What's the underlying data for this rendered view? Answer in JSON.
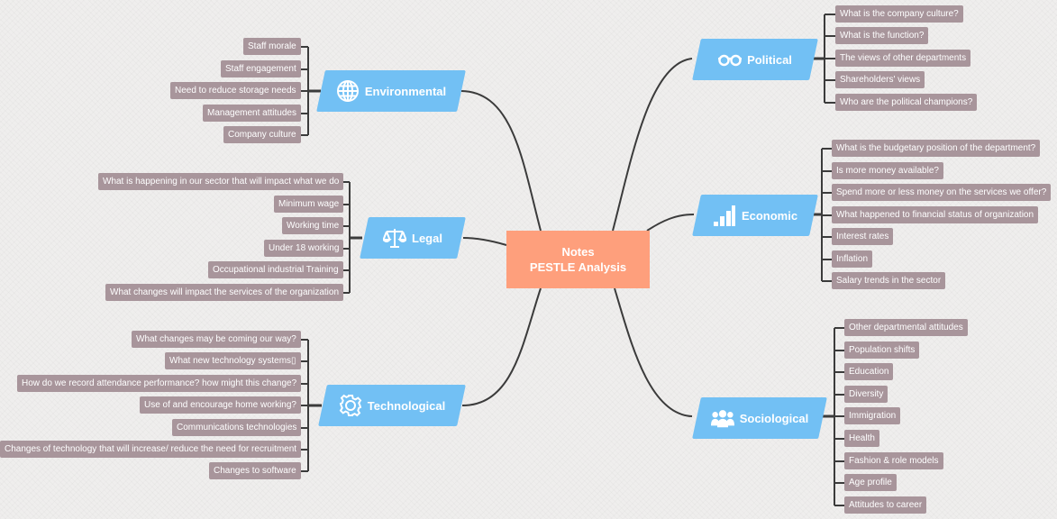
{
  "central": {
    "line1": "Notes",
    "line2": "PESTLE Analysis"
  },
  "colors": {
    "central": "#fe9f7c",
    "topic": "#72c0f4",
    "leaf": "#a8959b",
    "line": "#3b3b3b"
  },
  "topics": {
    "political": {
      "label": "Political",
      "icon": "glasses-icon",
      "items": [
        "What is the company culture?",
        "What is the function?",
        "The views of other departments",
        "Shareholders' views",
        "Who are the political champions?"
      ]
    },
    "economic": {
      "label": "Economic",
      "icon": "bar-chart-icon",
      "items": [
        "What is the budgetary position of the department?",
        "Is more money available?",
        "Spend more or less money on the services we offer?",
        "What happened to financial status of organization",
        "Interest rates",
        "Inflation",
        "Salary trends in the sector"
      ]
    },
    "sociological": {
      "label": "Sociological",
      "icon": "people-icon",
      "items": [
        "Other departmental attitudes",
        "Population shifts",
        "Education",
        "Diversity",
        "Immigration",
        "Health",
        "Fashion & role models",
        "Age profile",
        "Attitudes to career"
      ]
    },
    "environmental": {
      "label": "Environmental",
      "icon": "globe-icon",
      "items": [
        "Staff morale",
        "Staff engagement",
        "Need to reduce storage needs",
        "Management attitudes",
        "Company culture"
      ]
    },
    "legal": {
      "label": "Legal",
      "icon": "scales-icon",
      "items": [
        "What is happening in our sector that will impact what we do",
        "Minimum wage",
        "Working time",
        "Under 18 working",
        "Occupational industrial Training",
        "What changes will impact the services of the organization"
      ]
    },
    "technological": {
      "label": "Technological",
      "icon": "gear-icon",
      "items": [
        "What changes may be coming our way?",
        "What new technology systems▯",
        "How do we record attendance performance? how might this change?",
        "Use of and encourage home working?",
        "Communications technologies",
        "Changes of technology that will increase/ reduce the need for recruitment",
        "Changes to software"
      ]
    }
  }
}
